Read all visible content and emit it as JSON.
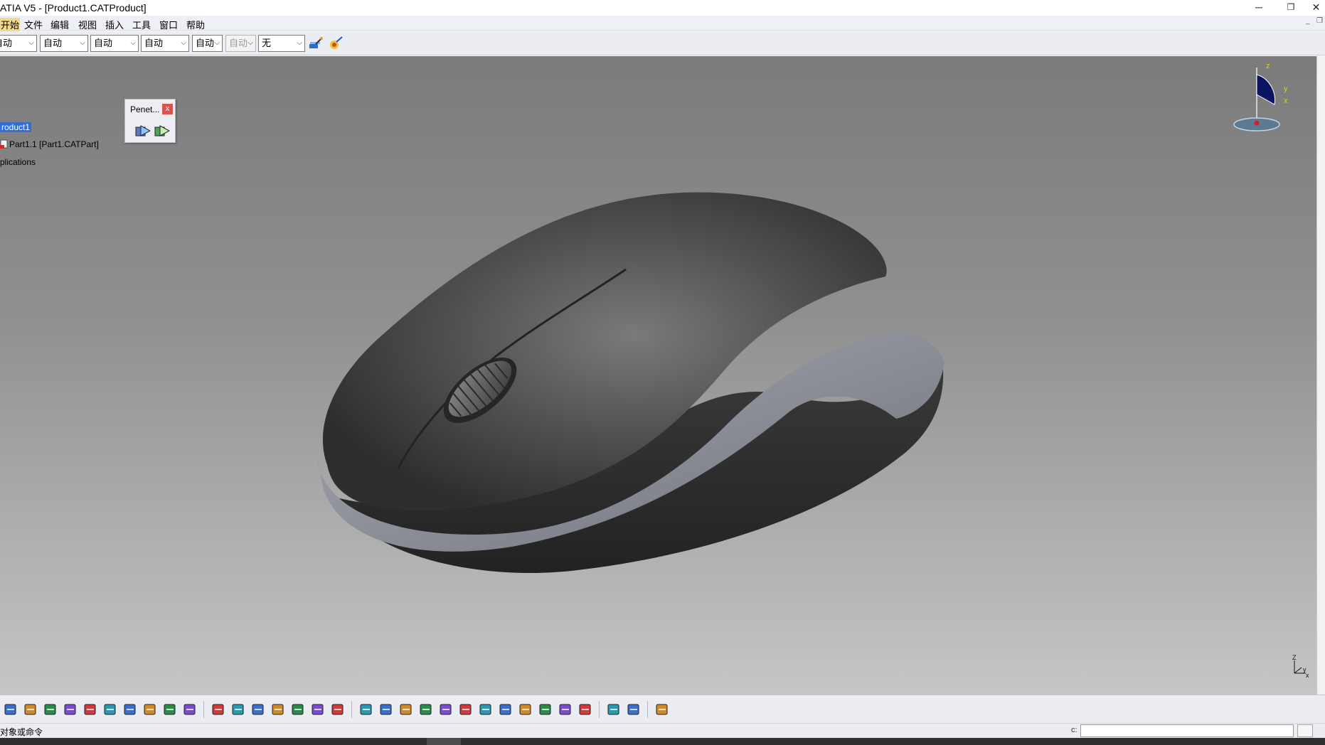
{
  "window": {
    "title": "ATIA V5 - [Product1.CATProduct]",
    "minimize": "─",
    "restore": "❐",
    "close": "✕"
  },
  "menu": [
    "开始",
    "文件",
    "编辑",
    "视图",
    "插入",
    "工具",
    "窗口",
    "帮助"
  ],
  "toolbar_top": {
    "combos": [
      {
        "value": "自动"
      },
      {
        "value": "自动"
      },
      {
        "value": "自动"
      },
      {
        "value": "自动"
      },
      {
        "value": "自动"
      },
      {
        "value": "自动",
        "disabled": true
      },
      {
        "value": "无"
      }
    ],
    "tools": [
      "painter-brush-icon",
      "graphic-properties-icon"
    ]
  },
  "tree": {
    "root": "roduct1",
    "part": "Part1.1 [Part1.CATPart]",
    "applications": "plications"
  },
  "palette": {
    "title": "Penet...",
    "close": "x"
  },
  "compass": {
    "z": "z",
    "y": "y",
    "x": "x"
  },
  "triad": {
    "z": "Z",
    "y": "y",
    "x": "x"
  },
  "bottom_toolbar": {
    "groups": [
      [
        "new-icon",
        "open-icon",
        "save-icon",
        "print-icon",
        "cut-icon",
        "copy-icon",
        "paste-icon",
        "undo-icon",
        "redo-icon",
        "whats-this-icon"
      ],
      [
        "formula-icon",
        "comment-icon",
        "knowledge-icon",
        "table-icon",
        "tree-expand-icon",
        "catalog-icon",
        "product-structure-icon"
      ],
      [
        "fly-mode-icon",
        "fit-all-icon",
        "pan-icon",
        "rotate-icon",
        "zoom-in-icon",
        "zoom-out-icon",
        "normal-view-icon",
        "multi-view-icon",
        "iso-view-icon",
        "shading-icon",
        "hide-show-icon",
        "swap-space-icon"
      ],
      [
        "analyze-icon",
        "sectioning-icon"
      ],
      [
        "capture-icon"
      ]
    ]
  },
  "status": {
    "message": "对象或命令",
    "cmd_label": "c:",
    "cmd_value": ""
  },
  "colors": {
    "accent": "#2f6fd6",
    "menu_active": "#f3d98a",
    "viewport_top": "#7b7b7b",
    "viewport_bottom": "#c6c6c6"
  }
}
